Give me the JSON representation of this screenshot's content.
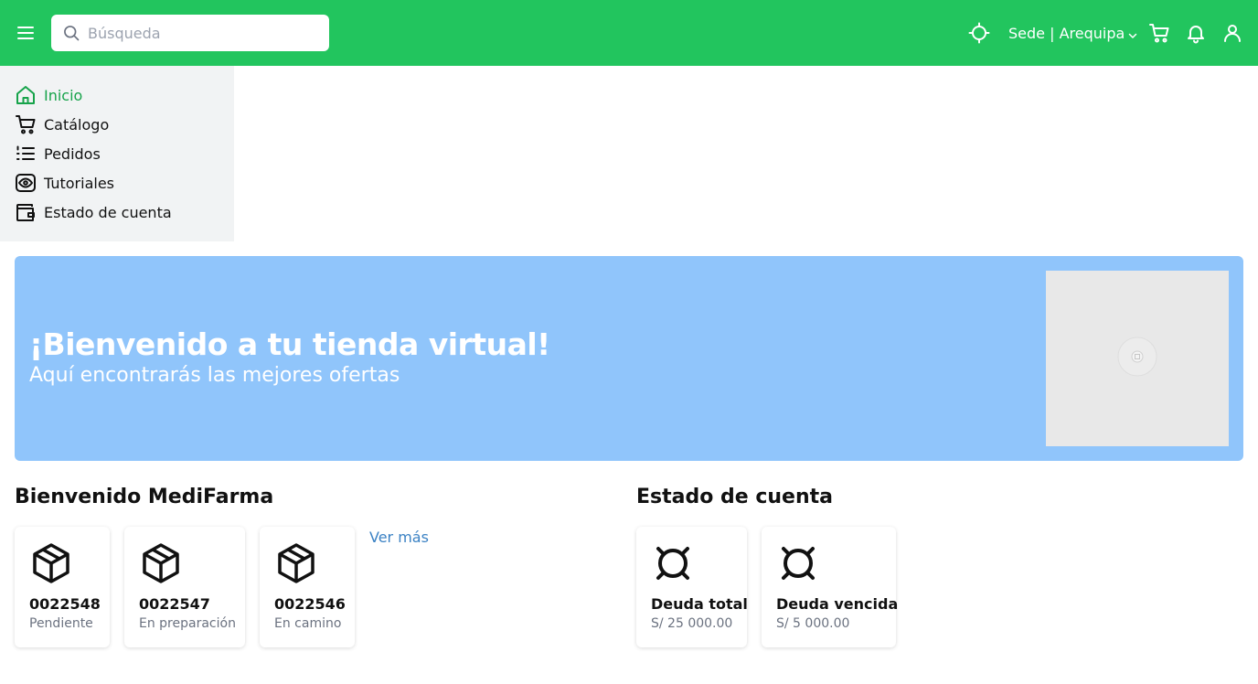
{
  "header": {
    "search": {
      "placeholder": "Búsqueda",
      "value": ""
    },
    "sede_label": "Sede | Arequipa",
    "icons": [
      "menu-icon",
      "search-icon",
      "location-icon",
      "chevron-down-icon",
      "cart-icon",
      "bell-icon",
      "user-icon"
    ]
  },
  "sidebar": {
    "items": [
      {
        "label": "Inicio",
        "icon": "home-icon",
        "active": true
      },
      {
        "label": "Catálogo",
        "icon": "cart-icon",
        "active": false
      },
      {
        "label": "Pedidos",
        "icon": "list-icon",
        "active": false
      },
      {
        "label": "Tutoriales",
        "icon": "eye-icon",
        "active": false
      },
      {
        "label": "Estado de cuenta",
        "icon": "wallet-icon",
        "active": false
      }
    ]
  },
  "banner": {
    "title": "¡Bienvenido a tu tienda virtual!",
    "subtitle": "Aquí encontrarás las mejores ofertas"
  },
  "orders_section": {
    "title": "Bienvenido MediFarma",
    "more_link": "Ver más",
    "orders": [
      {
        "number": "0022548",
        "status": "Pendiente",
        "icon": "box-icon"
      },
      {
        "number": "0022547",
        "status": "En preparación",
        "icon": "box-icon"
      },
      {
        "number": "0022546",
        "status": "En camino",
        "icon": "box-icon"
      }
    ]
  },
  "account_section": {
    "title": "Estado de cuenta",
    "items": [
      {
        "label": "Deuda total",
        "amount": "S/ 25 000.00",
        "icon": "currency-icon"
      },
      {
        "label": "Deuda vencida",
        "amount": "S/ 5 000.00",
        "icon": "currency-icon"
      }
    ]
  },
  "colors": {
    "header_bg": "#22c55e",
    "sidebar_bg": "#f1f3f4",
    "active_nav": "#16a34a",
    "banner_bg": "#90c5fb",
    "link": "#3b82c4",
    "muted_text": "#6b7280"
  }
}
